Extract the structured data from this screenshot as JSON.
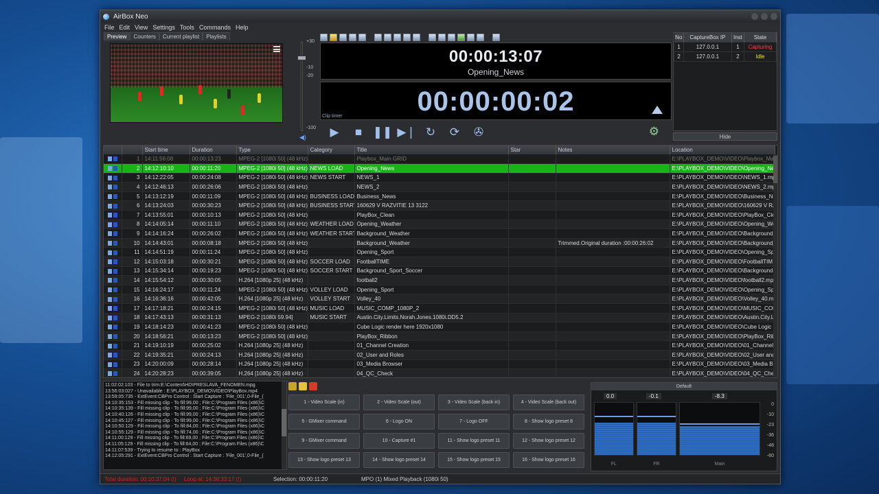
{
  "window": {
    "title": "AirBox Neo"
  },
  "menu": [
    "File",
    "Edit",
    "View",
    "Settings",
    "Tools",
    "Commands",
    "Help"
  ],
  "tabs": [
    "Preview",
    "Counters",
    "Current playlist",
    "Playlists"
  ],
  "fader": {
    "labels": [
      "+30",
      "-10",
      "-20",
      "-100"
    ]
  },
  "clocks": {
    "main_time": "00:00:13:07",
    "clip_name": "Opening_News",
    "clip_timer": "00:00:00:02",
    "clip_timer_label": "Clip timer"
  },
  "transport": {
    "icons": [
      "play-icon",
      "stop-icon",
      "pause-icon",
      "skip-next-icon",
      "reload-icon",
      "refresh-icon",
      "film-reel-icon"
    ],
    "glyphs": [
      "▶",
      "■",
      "❚❚",
      "▶❘",
      "↻",
      "⟳",
      "✇"
    ],
    "settings_glyph": "⚙"
  },
  "capture": {
    "headers": [
      "No",
      "CaptureBox IP",
      "Inst",
      "State"
    ],
    "rows": [
      {
        "no": "1",
        "ip": "127.0.0.1",
        "inst": "1",
        "state": "Capturing",
        "color": "#ff3b3b"
      },
      {
        "no": "2",
        "ip": "127.0.0.1",
        "inst": "2",
        "state": "Idle",
        "color": "#f2e24a"
      }
    ],
    "hide_label": "Hide"
  },
  "playlist": {
    "columns": [
      "",
      "Start time",
      "Duration",
      "Type",
      "Category",
      "Title",
      "Star",
      "Notes",
      "Location"
    ],
    "rows": [
      {
        "n": "1",
        "start": "14:11:56:08",
        "dur": "00:00:13:23",
        "type": "MPEG-2 [1080i 50] (48 kHz)",
        "cat": "",
        "title": "Playbox_Main GRID",
        "star": "",
        "notes": "",
        "loc": "E:\\PLAYBOX_DEMO\\VIDEO\\Playbox_Mai",
        "state": "played"
      },
      {
        "n": "2",
        "start": "14:12:10:10",
        "dur": "00:00:11:20",
        "type": "MPEG-2 [1080i 50] (48 kHz)",
        "cat": "NEWS LOAD",
        "title": "Opening_News",
        "star": "",
        "notes": "",
        "loc": "E:\\PLAYBOX_DEMO\\VIDEO\\Opening_Ne",
        "state": "active"
      },
      {
        "n": "3",
        "start": "14:12:22:05",
        "dur": "00:00:24:08",
        "type": "MPEG-2 [1080i 50] (48 kHz)",
        "cat": "NEWS START",
        "title": "NEWS_1",
        "star": "",
        "notes": "",
        "loc": "E:\\PLAYBOX_DEMO\\VIDEO\\NEWS_1.mp",
        "state": ""
      },
      {
        "n": "4",
        "start": "14:12:46:13",
        "dur": "00:00:26:06",
        "type": "MPEG-2 [1080i 50] (48 kHz)",
        "cat": "",
        "title": "NEWS_2",
        "star": "",
        "notes": "",
        "loc": "E:\\PLAYBOX_DEMO\\VIDEO\\NEWS_2.mp",
        "state": ""
      },
      {
        "n": "5",
        "start": "14:13:12:19",
        "dur": "00:00:11:09",
        "type": "MPEG-2 [1080i 50] (48 kHz)",
        "cat": "BUSINESS LOAD",
        "title": "Business_News",
        "star": "",
        "notes": "",
        "loc": "E:\\PLAYBOX_DEMO\\VIDEO\\Business_Ne",
        "state": ""
      },
      {
        "n": "6",
        "start": "14:13:24:03",
        "dur": "00:00:30:23",
        "type": "MPEG-2 [1080i 50] (48 kHz)",
        "cat": "BUSINESS START",
        "title": "160629 V RAZVITIE 13 3122",
        "star": "",
        "notes": "",
        "loc": "E:\\PLAYBOX_DEMO\\VIDEO\\160629 V RA",
        "state": ""
      },
      {
        "n": "7",
        "start": "14:13:55:01",
        "dur": "00:00:10:13",
        "type": "MPEG-2 [1080i 50] (48 kHz)",
        "cat": "",
        "title": "PlayBox_Clean",
        "star": "",
        "notes": "",
        "loc": "E:\\PLAYBOX_DEMO\\VIDEO\\PlayBox_Cle",
        "state": ""
      },
      {
        "n": "8",
        "start": "14:14:05:14",
        "dur": "00:00:11:10",
        "type": "MPEG-2 [1080i 50] (48 kHz)",
        "cat": "WEATHER LOAD",
        "title": "Opening_Weather",
        "star": "",
        "notes": "",
        "loc": "E:\\PLAYBOX_DEMO\\VIDEO\\Opening_We",
        "state": ""
      },
      {
        "n": "9",
        "start": "14:14:16:24",
        "dur": "00:00:26:02",
        "type": "MPEG-2 [1080i 50] (48 kHz)",
        "cat": "WEATHER START",
        "title": "Background_Weather",
        "star": "",
        "notes": "",
        "loc": "E:\\PLAYBOX_DEMO\\VIDEO\\Background_",
        "state": ""
      },
      {
        "n": "10",
        "start": "14:14:43:01",
        "dur": "00:00:08:18",
        "type": "MPEG-2 [1080i 50] (48 kHz)",
        "cat": "",
        "title": "Background_Weather",
        "star": "",
        "notes": "Trimmed.Original duration :00:00:26:02",
        "loc": "E:\\PLAYBOX_DEMO\\VIDEO\\Background_",
        "state": ""
      },
      {
        "n": "11",
        "start": "14:14:51:19",
        "dur": "00:00:11:24",
        "type": "MPEG-2 [1080i 50] (48 kHz)",
        "cat": "",
        "title": "Opening_Sport",
        "star": "",
        "notes": "",
        "loc": "E:\\PLAYBOX_DEMO\\VIDEO\\Opening_Sp",
        "state": ""
      },
      {
        "n": "12",
        "start": "14:15:03:18",
        "dur": "00:00:30:21",
        "type": "MPEG-2 [1080i 50] (48 kHz)",
        "cat": "SOCCER LOAD",
        "title": "FootballTIME",
        "star": "",
        "notes": "",
        "loc": "E:\\PLAYBOX_DEMO\\VIDEO\\FootballTIM",
        "state": ""
      },
      {
        "n": "13",
        "start": "14:15:34:14",
        "dur": "00:00:19:23",
        "type": "MPEG-2 [1080i 50] (48 kHz)",
        "cat": "SOCCER START",
        "title": "Background_Sport_Soccer",
        "star": "",
        "notes": "",
        "loc": "E:\\PLAYBOX_DEMO\\VIDEO\\Background",
        "state": ""
      },
      {
        "n": "14",
        "start": "14:15:54:12",
        "dur": "00:00:30:05",
        "type": "H.264 [1080p 25] (48 kHz)",
        "cat": "",
        "title": "football2",
        "star": "",
        "notes": "",
        "loc": "E:\\PLAYBOX_DEMO\\VIDEO\\football2.mp",
        "state": ""
      },
      {
        "n": "15",
        "start": "14:16:24:17",
        "dur": "00:00:11:24",
        "type": "MPEG-2 [1080i 50] (48 kHz)",
        "cat": "VOLLEY LOAD",
        "title": "Opening_Sport",
        "star": "",
        "notes": "",
        "loc": "E:\\PLAYBOX_DEMO\\VIDEO\\Opening_Sp",
        "state": ""
      },
      {
        "n": "16",
        "start": "14:16:36:16",
        "dur": "00:00:42:05",
        "type": "H.264 [1080p 25] (48 kHz)",
        "cat": "VOLLEY START",
        "title": "Volley_40",
        "star": "",
        "notes": "",
        "loc": "E:\\PLAYBOX_DEMO\\VIDEO\\Volley_40.mp",
        "state": ""
      },
      {
        "n": "17",
        "start": "14:17:18:21",
        "dur": "00:00:24:15",
        "type": "MPEG-2 [1080i 50] (48 kHz)",
        "cat": "MUSIC LOAD",
        "title": "MUSIC_COMP_1080P_2",
        "star": "",
        "notes": "",
        "loc": "E:\\PLAYBOX_DEMO\\VIDEO\\MUSIC_COM",
        "state": ""
      },
      {
        "n": "18",
        "start": "14:17:43:13",
        "dur": "00:00:31:13",
        "type": "MPEG-2 [1080i 59.94]",
        "cat": "MUSIC START",
        "title": "Austin.City.Limits.Norah.Jones.1080i.DD5.2",
        "star": "",
        "notes": "",
        "loc": "E:\\PLAYBOX_DEMO\\VIDEO\\Austin.City.L",
        "state": ""
      },
      {
        "n": "19",
        "start": "14:18:14:23",
        "dur": "00:00:41:23",
        "type": "MPEG-2 [1080i 50] (48 kHz)",
        "cat": "",
        "title": "Cube Logic render here 1920x1080",
        "star": "",
        "notes": "",
        "loc": "E:\\PLAYBOX_DEMO\\VIDEO\\Cube Logic r",
        "state": ""
      },
      {
        "n": "20",
        "start": "14:18:56:21",
        "dur": "00:00:13:23",
        "type": "MPEG-2 [1080i 50] (48 kHz)",
        "cat": "",
        "title": "PlayBox_Ribbon",
        "star": "",
        "notes": "",
        "loc": "E:\\PLAYBOX_DEMO\\VIDEO\\PlayBox_Ribb",
        "state": ""
      },
      {
        "n": "21",
        "start": "14:19:10:19",
        "dur": "00:00:25:02",
        "type": "H.264 [1080p 25] (48 kHz)",
        "cat": "",
        "title": "01_Channel Creation",
        "star": "",
        "notes": "",
        "loc": "E:\\PLAYBOX_DEMO\\VIDEO\\01_Channel",
        "state": ""
      },
      {
        "n": "22",
        "start": "14:19:35:21",
        "dur": "00:00:24:13",
        "type": "H.264 [1080p 25] (48 kHz)",
        "cat": "",
        "title": "02_User and Roles",
        "star": "",
        "notes": "",
        "loc": "E:\\PLAYBOX_DEMO\\VIDEO\\02_User and",
        "state": ""
      },
      {
        "n": "23",
        "start": "14:20:00:09",
        "dur": "00:00:28:14",
        "type": "H.264 [1080p 25] (48 kHz)",
        "cat": "",
        "title": "03_Media Browser",
        "star": "",
        "notes": "",
        "loc": "E:\\PLAYBOX_DEMO\\VIDEO\\03_Media Br",
        "state": ""
      },
      {
        "n": "24",
        "start": "14:20:28:23",
        "dur": "00:00:39:05",
        "type": "H.264 [1080p 25] (48 kHz)",
        "cat": "",
        "title": "04_QC_Check",
        "star": "",
        "notes": "",
        "loc": "E:\\PLAYBOX_DEMO\\VIDEO\\04_QC_Chec",
        "state": ""
      }
    ]
  },
  "log": [
    "11:02:02:103 - File to trim:E:\\Content\\HD\\PRESLAVA_FENOMEN.mpg",
    "13:56:03:027 - Unavailable : E:\\PLAYBOX_DEMO\\VIDEO\\PlayBox.mp4",
    "13:59:05:735 - ExtEvent:CBPro Control : Start Capture : 'File_001',0-File_(",
    "14:10:35:153 - Fill missing clip - To fill:99,00 ; File:C:\\Program Files (x86)\\C",
    "14:10:35:139 - Fill missing clip - To fill:99,00 ; File:C:\\Program Files (x86)\\C",
    "14:10:40:126 - Fill missing clip - To fill:99,00 ; File:C:\\Program Files (x86)\\C",
    "14:10:45:127 - Fill missing clip - To fill:99,00 ; File:C:\\Program Files (x86)\\C",
    "14:10:50:129 - Fill missing clip - To fill:84,00 ; File:C:\\Program Files (x86)\\C",
    "14:10:55:129 - Fill missing clip - To fill:74,00 ; File:C:\\Program Files (x86)\\C",
    "14:11:00:129 - Fill missing clip - To fill:69,00 ; File:C:\\Program Files (x86)\\C",
    "14:11:05:129 - Fill missing clip - To fill:64,00 ; File:C:\\Program Files (x86)\\C",
    "14:11:07:539 - Trying to resume to : PlayBox",
    "14:12:05:291 - ExtEvent:CBPro Control : Start Capture : 'File_001',0-File_("
  ],
  "commands": [
    "1 - Video Scale (in)",
    "2 - Video Scale (out)",
    "3 - Video Scale (back in)",
    "4 - Video Scale (back out)",
    "5 - GMixer command",
    "6 - Logo ON",
    "7 - Logo OFF",
    "8 - Show logo preset 8",
    "9 - GMixer command",
    "10 - Capture #1",
    "11 - Show logo preset 11",
    "12 - Show logo preset 12",
    "13 - Show logo preset 13",
    "14 - Show logo preset 14",
    "15 - Show logo preset 15",
    "16 - Show logo preset 16"
  ],
  "audio": {
    "preset": "Default",
    "readouts": [
      "0.0",
      "-0.1",
      "-8.3"
    ],
    "channels": [
      {
        "name": "FL",
        "level": 0.62,
        "peak": 0.72
      },
      {
        "name": "FR",
        "level": 0.62,
        "peak": 0.72
      },
      {
        "name": "Main",
        "level": 0.55,
        "peak": 0.58
      }
    ],
    "scale": [
      "0",
      "-10",
      "-23",
      "-36",
      "-48",
      "-60"
    ]
  },
  "status": {
    "total_duration": "Total duration: 00:10:37:04 (!)",
    "loop_at": "Loop at: 14:38:33:17 (!)",
    "selection": "Selection: 00:00:11:20",
    "mpo": "MPO (1) Mixed Playback (1080i 50)"
  },
  "colors": {
    "accent_active": "#17b317",
    "clock_blue": "#a9c4e8",
    "alert": "#d22"
  }
}
